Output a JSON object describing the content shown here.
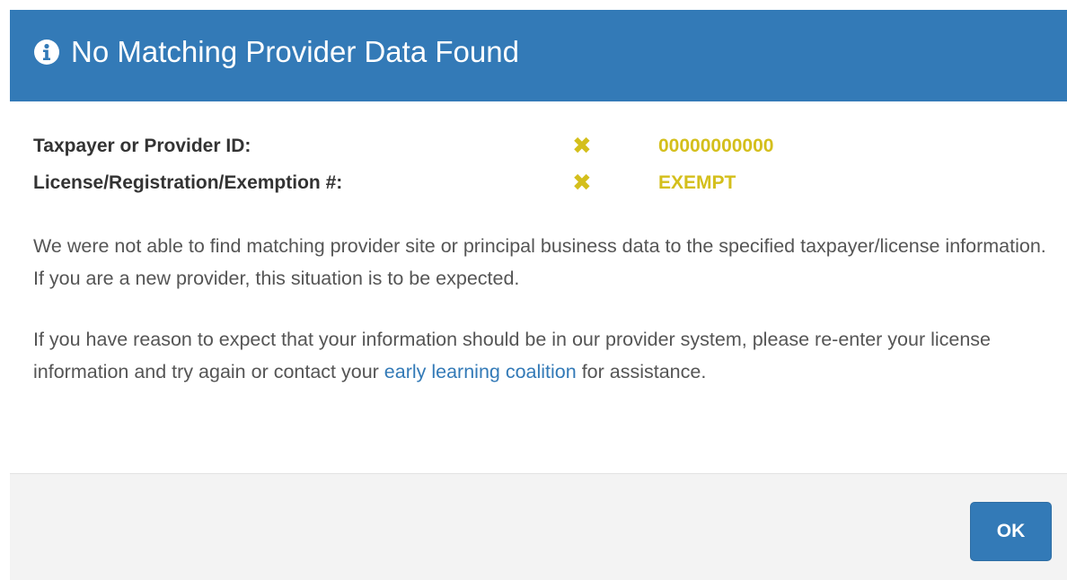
{
  "dialog": {
    "title": "No Matching Provider Data Found",
    "title_icon": "info-circle-icon",
    "header_color": "#337ab7"
  },
  "fields": [
    {
      "label": "Taxpayer or Provider ID:",
      "status_icon": "x-mark-icon",
      "value": "00000000000"
    },
    {
      "label": "License/Registration/Exemption #:",
      "status_icon": "x-mark-icon",
      "value": "EXEMPT"
    }
  ],
  "status_color": "#d4bf1c",
  "message": {
    "paragraph1": "We were not able to find matching provider site or principal business data to the specified taxpayer/license information. If you are a new provider, this situation is to be expected.",
    "paragraph2_before": "If you have reason to expect that your information should be in our provider system, please re-enter your license information and try again or contact your ",
    "paragraph2_link": "early learning coalition",
    "paragraph2_after": " for assistance."
  },
  "footer": {
    "ok_label": "OK"
  }
}
